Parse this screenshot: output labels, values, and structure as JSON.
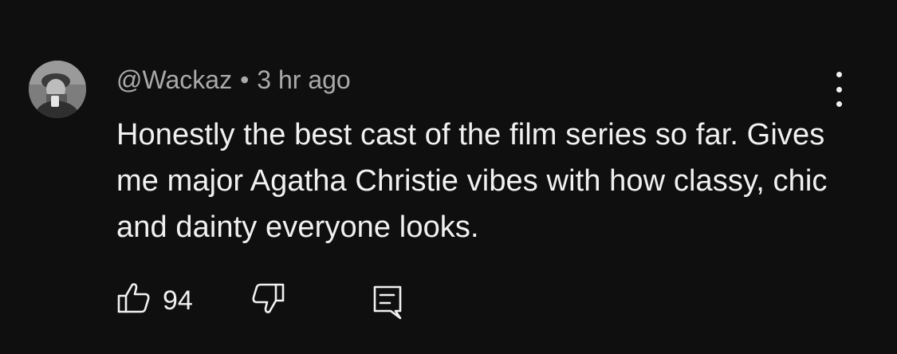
{
  "comment": {
    "author": "@Wackaz",
    "separator": "•",
    "timestamp": "3 hr ago",
    "text": "Honestly the best cast of the film series so far. Gives me major Agatha Christie vibes with how classy, chic and dainty everyone looks.",
    "like_count": "94"
  },
  "icons": {
    "avatar": "avatar-photo",
    "more": "more-vertical-icon",
    "like": "thumbs-up-icon",
    "dislike": "thumbs-down-icon",
    "reply": "reply-comment-icon"
  },
  "colors": {
    "background": "#0f0f0f",
    "primary_text": "#f1f1f1",
    "secondary_text": "#aaaaaa"
  }
}
